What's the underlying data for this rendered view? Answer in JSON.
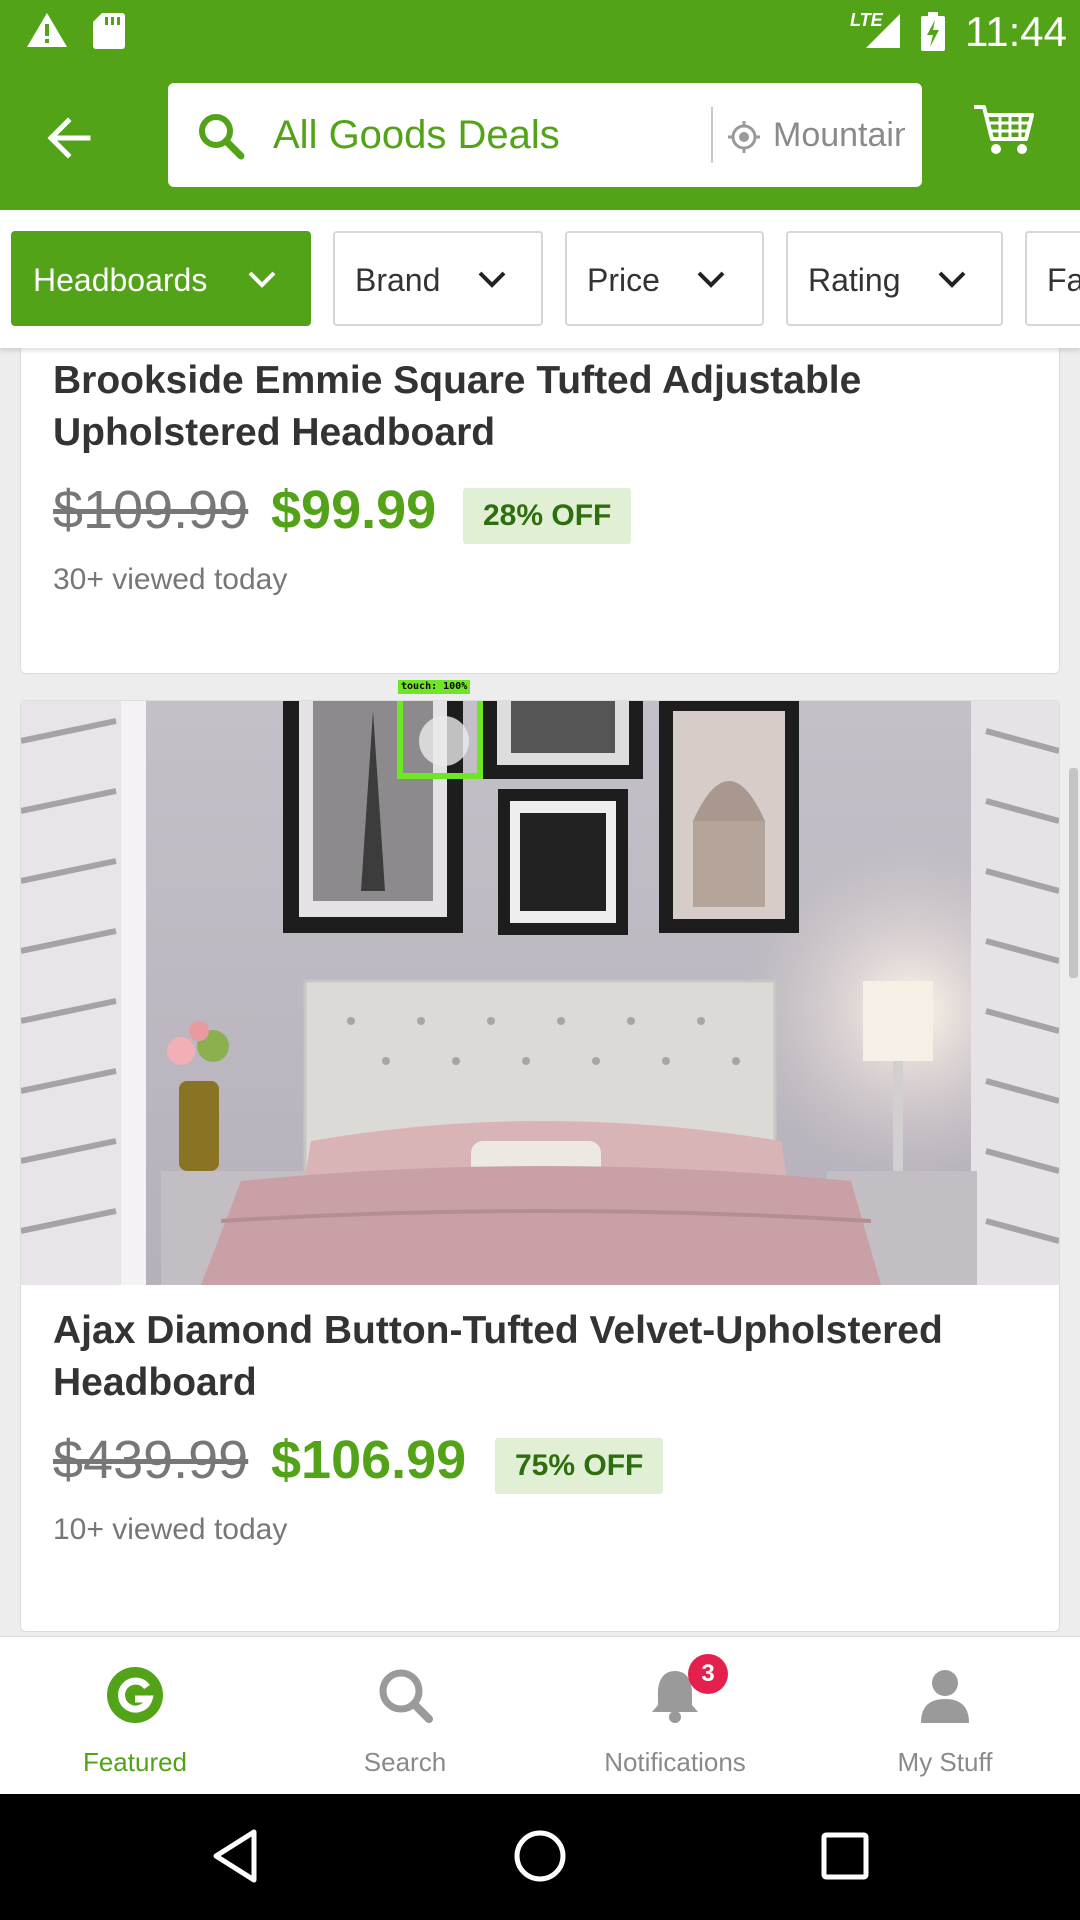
{
  "status_bar": {
    "network": "LTE",
    "time": "11:44"
  },
  "header": {
    "search_text": "All Goods Deals",
    "location_text": "Mountain"
  },
  "filters": [
    {
      "label": "Headboards",
      "active": true
    },
    {
      "label": "Brand",
      "active": false
    },
    {
      "label": "Price",
      "active": false
    },
    {
      "label": "Rating",
      "active": false
    },
    {
      "label": "Fa",
      "active": false
    }
  ],
  "deals": [
    {
      "title": "Brookside Emmie Square Tufted Adjustable Upholstered Headboard",
      "original_price": "$109.99",
      "price": "$99.99",
      "discount": "28% OFF",
      "viewed": "30+ viewed today"
    },
    {
      "title": "Ajax Diamond Button-Tufted Velvet-Upholstered Headboard",
      "original_price": "$439.99",
      "price": "$106.99",
      "discount": "75% OFF",
      "viewed": "10+ viewed today"
    }
  ],
  "touch_indicator": "touch: 100%",
  "bottom_nav": [
    {
      "label": "Featured",
      "icon": "groupon-g-icon",
      "active": true
    },
    {
      "label": "Search",
      "icon": "search-icon",
      "active": false
    },
    {
      "label": "Notifications",
      "icon": "bell-icon",
      "active": false,
      "badge": "3"
    },
    {
      "label": "My Stuff",
      "icon": "person-icon",
      "active": false
    }
  ],
  "colors": {
    "brand_green": "#53a318",
    "discount_badge_bg": "#e1efd5",
    "notification_badge": "#e5204d"
  }
}
